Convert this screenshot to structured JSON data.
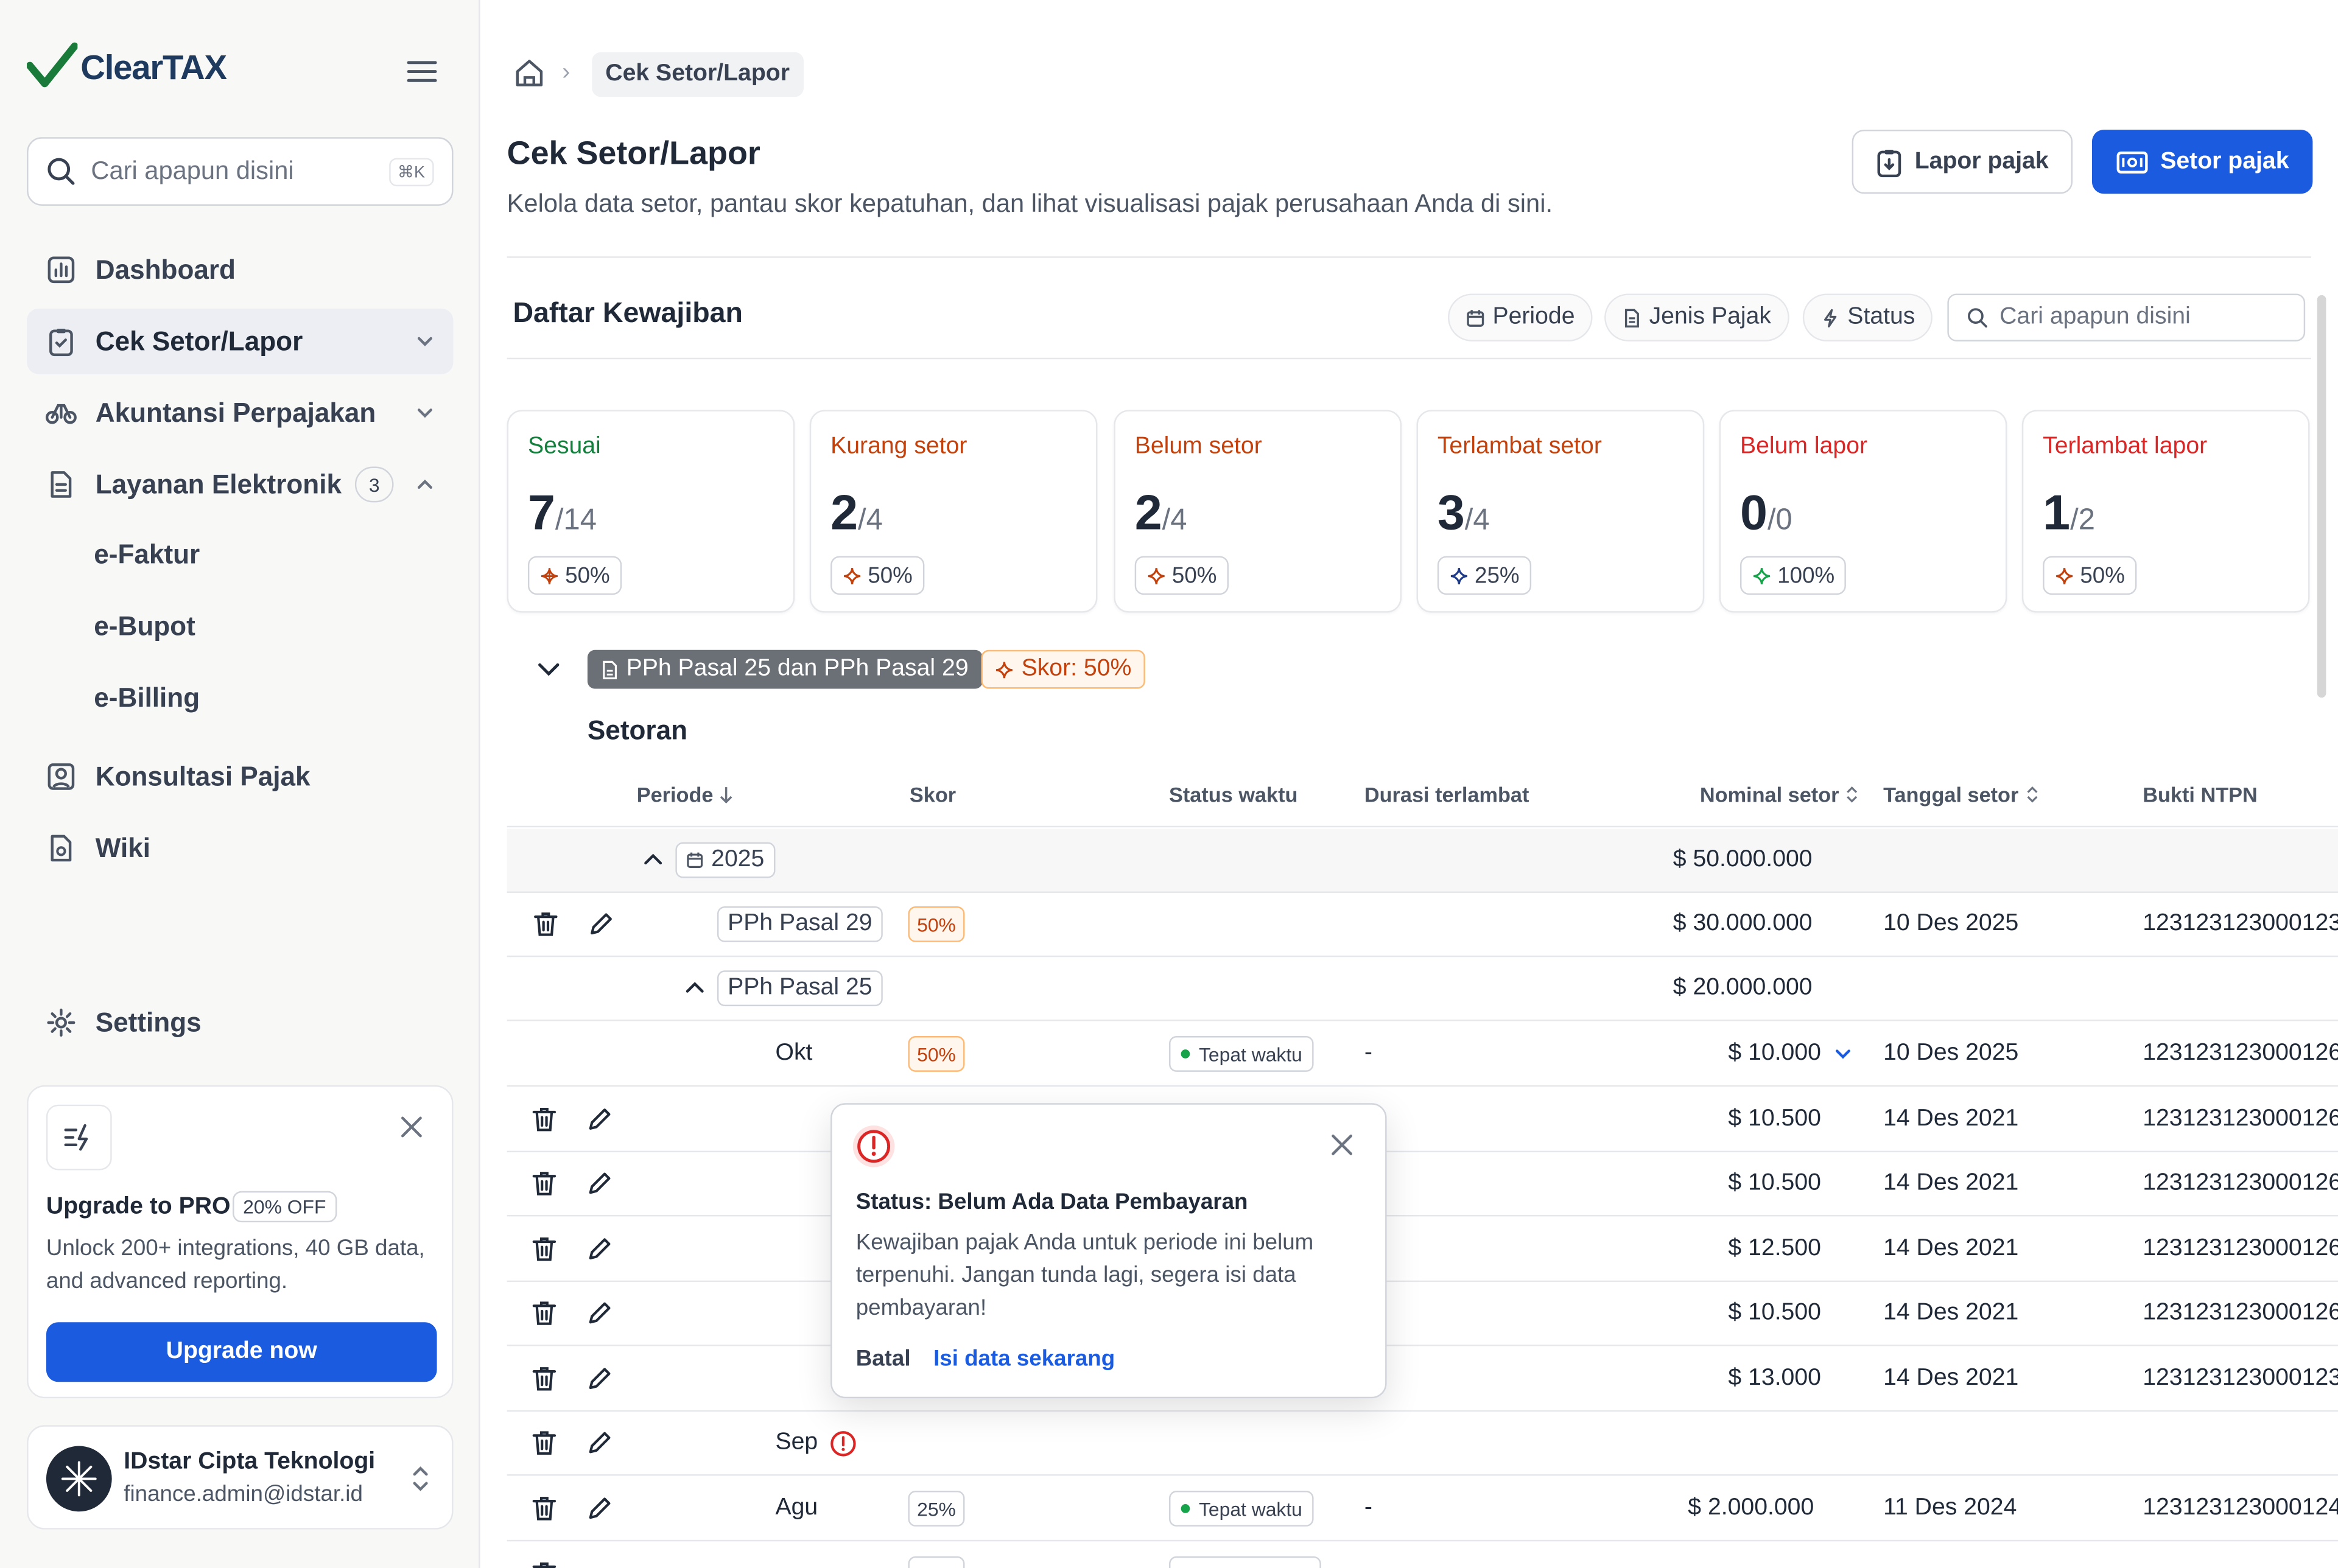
{
  "app": {
    "logo_text": "ClearTAX"
  },
  "sidebar": {
    "search_placeholder": "Cari apapun disini",
    "search_shortcut": "⌘K",
    "items": [
      {
        "label": "Dashboard",
        "icon": "chart-icon"
      },
      {
        "label": "Cek Setor/Lapor",
        "icon": "clipboard-check-icon"
      },
      {
        "label": "Akuntansi Perpajakan",
        "icon": "scale-icon"
      },
      {
        "label": "Layanan Elektronik",
        "icon": "document-icon",
        "badge": "3"
      },
      {
        "label": "Konsultasi Pajak",
        "icon": "user-square-icon"
      },
      {
        "label": "Wiki",
        "icon": "book-icon"
      }
    ],
    "sub_items": [
      "e-Faktur",
      "e-Bupot",
      "e-Billing"
    ],
    "settings_label": "Settings",
    "promo": {
      "title": "Upgrade to PRO",
      "badge": "20% OFF",
      "description": "Unlock 200+ integrations, 40 GB data, and advanced reporting.",
      "button": "Upgrade now"
    },
    "account": {
      "name": "IDstar Cipta Teknologi",
      "email": "finance.admin@idstar.id"
    }
  },
  "breadcrumb": {
    "current": "Cek Setor/Lapor"
  },
  "header": {
    "title": "Cek Setor/Lapor",
    "description": "Kelola data setor, pantau skor kepatuhan, dan lihat visualisasi pajak perusahaan Anda di sini.",
    "btn_lapor": "Lapor pajak",
    "btn_setor": "Setor pajak"
  },
  "section": {
    "title": "Daftar Kewajiban",
    "filters": [
      "Periode",
      "Jenis Pajak",
      "Status"
    ],
    "search_placeholder": "Cari apapun disini"
  },
  "cards": [
    {
      "label": "Sesuai",
      "value": "7",
      "total": "/14",
      "pct": "50%",
      "color": "#15803d"
    },
    {
      "label": "Kurang setor",
      "value": "2",
      "total": "/4",
      "pct": "50%",
      "color": "#c2410c"
    },
    {
      "label": "Belum setor",
      "value": "2",
      "total": "/4",
      "pct": "50%",
      "color": "#c2410c"
    },
    {
      "label": "Terlambat setor",
      "value": "3",
      "total": "/4",
      "pct": "25%",
      "color": "#c2410c"
    },
    {
      "label": "Belum lapor",
      "value": "0",
      "total": "/0",
      "pct": "100%",
      "color": "#dc2626"
    },
    {
      "label": "Terlambat lapor",
      "value": "1",
      "total": "/2",
      "pct": "50%",
      "color": "#dc2626"
    }
  ],
  "group": {
    "tag": "PPh Pasal 25 dan PPh Pasal 29",
    "score": "Skor: 50%",
    "subtitle": "Setoran"
  },
  "table": {
    "headers": [
      "Periode",
      "Skor",
      "Status waktu",
      "Durasi terlambat",
      "Nominal setor",
      "Tanggal setor",
      "Bukti NTPN"
    ],
    "year_row": {
      "year": "2025",
      "nominal": "$ 50.000.000"
    },
    "pph29_row": {
      "label": "PPh Pasal 29",
      "skor": "50%",
      "nominal": "$ 30.000.000",
      "tanggal": "10 Des 2025",
      "ntpn": "123123123000123"
    },
    "pph25_row": {
      "label": "PPh Pasal 25",
      "nominal": "$ 20.000.000"
    },
    "okt_row": {
      "periode": "Okt",
      "skor": "50%",
      "status": "Tepat waktu",
      "durasi": "-",
      "nominal": "$ 10.000",
      "tanggal": "10 Des 2025",
      "ntpn": "123123123000126"
    },
    "sub_rows": [
      {
        "nominal": "$ 10.500",
        "tanggal": "14 Des 2021",
        "ntpn": "123123123000126"
      },
      {
        "nominal": "$ 10.500",
        "tanggal": "14 Des 2021",
        "ntpn": "123123123000126"
      },
      {
        "nominal": "$ 12.500",
        "tanggal": "14 Des 2021",
        "ntpn": "123123123000126"
      },
      {
        "nominal": "$ 10.500",
        "tanggal": "14 Des 2021",
        "ntpn": "123123123000126"
      },
      {
        "nominal": "$ 13.000",
        "tanggal": "14 Des 2021",
        "ntpn": "123123123000123"
      }
    ],
    "sep_row": {
      "periode": "Sep"
    },
    "agu_row": {
      "periode": "Agu",
      "skor": "25%",
      "status": "Tepat waktu",
      "durasi": "-",
      "nominal": "$ 2.000.000",
      "tanggal": "11 Des 2024",
      "ntpn": "123123123000124"
    }
  },
  "popover": {
    "title": "Status: Belum Ada Data Pembayaran",
    "description": "Kewajiban pajak Anda untuk periode ini belum terpenuhi. Jangan tunda lagi, segera isi data pembayaran!",
    "cancel": "Batal",
    "action": "Isi data sekarang"
  }
}
